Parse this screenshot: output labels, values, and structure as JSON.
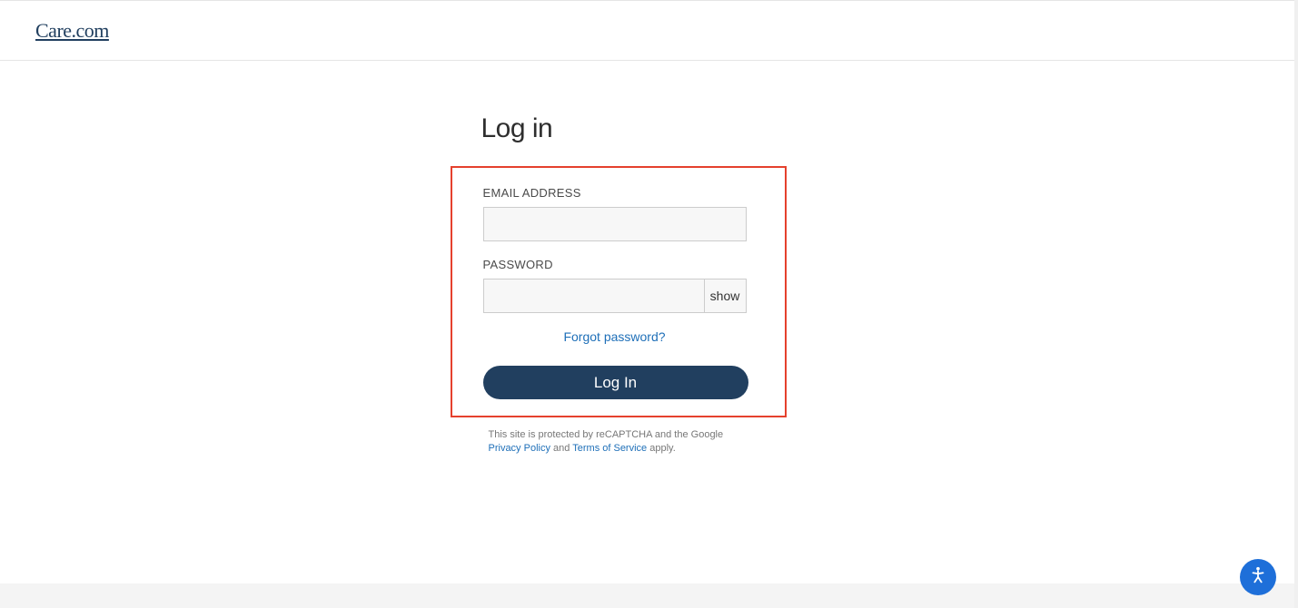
{
  "brand": {
    "name": "Care.com"
  },
  "page": {
    "title": "Log in"
  },
  "form": {
    "email_label": "EMAIL ADDRESS",
    "email_value": "",
    "password_label": "PASSWORD",
    "password_value": "",
    "show_label": "show",
    "forgot_label": "Forgot password?",
    "submit_label": "Log In"
  },
  "legal": {
    "prefix": "This site is protected by reCAPTCHA and the Google ",
    "privacy_label": "Privacy Policy",
    "and": " and ",
    "tos_label": "Terms of Service",
    "suffix": " apply."
  }
}
